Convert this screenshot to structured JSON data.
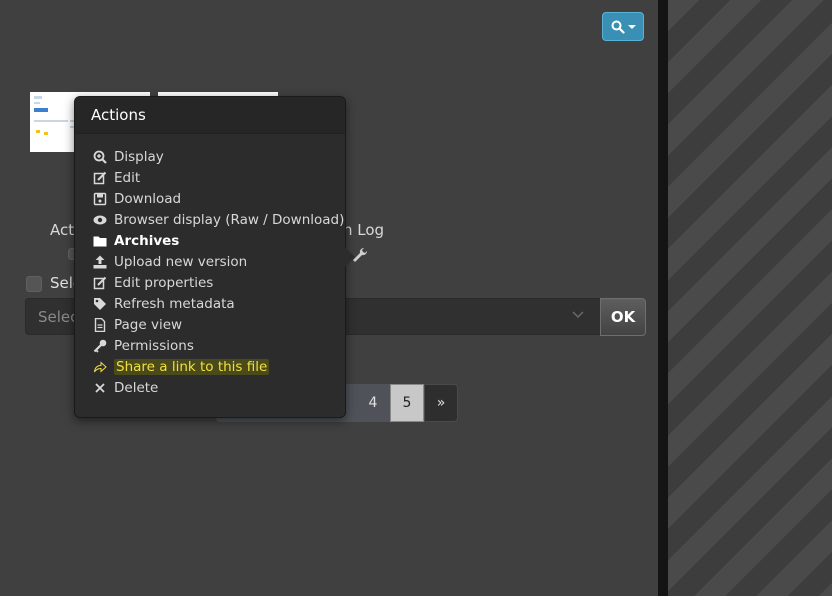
{
  "colors": {
    "background": "#404040",
    "popover": "#2c2c2c",
    "accent": "#3a8fb5",
    "highlight": "#f0e040",
    "stripes": "#4a4a4a"
  },
  "search_button": {
    "icon": "search-icon",
    "caret": "chevron-down-icon"
  },
  "partial_text": {
    "left": "Act",
    "right": "n Log"
  },
  "select_all": {
    "label": "Sele"
  },
  "select": {
    "placeholder": "Selec"
  },
  "ok_label": "OK",
  "pagination": {
    "pages": [
      "4",
      "5"
    ],
    "next": "»",
    "current": "5"
  },
  "popover": {
    "title": "Actions",
    "items": [
      {
        "label": "Display",
        "icon": "zoom-in-icon"
      },
      {
        "label": "Edit",
        "icon": "edit-icon"
      },
      {
        "label": "Download",
        "icon": "save-icon"
      },
      {
        "label": "Browser display (Raw / Download)",
        "icon": "eye-icon"
      },
      {
        "label": "Archives",
        "icon": "folder-icon"
      },
      {
        "label": "Upload new version",
        "icon": "upload-icon"
      },
      {
        "label": "Edit properties",
        "icon": "edit-icon"
      },
      {
        "label": "Refresh metadata",
        "icon": "tag-icon"
      },
      {
        "label": "Page view",
        "icon": "document-icon"
      },
      {
        "label": "Permissions",
        "icon": "key-icon"
      },
      {
        "label": "Share a link to this file",
        "icon": "share-icon"
      },
      {
        "label": "Delete",
        "icon": "close-icon"
      }
    ]
  }
}
